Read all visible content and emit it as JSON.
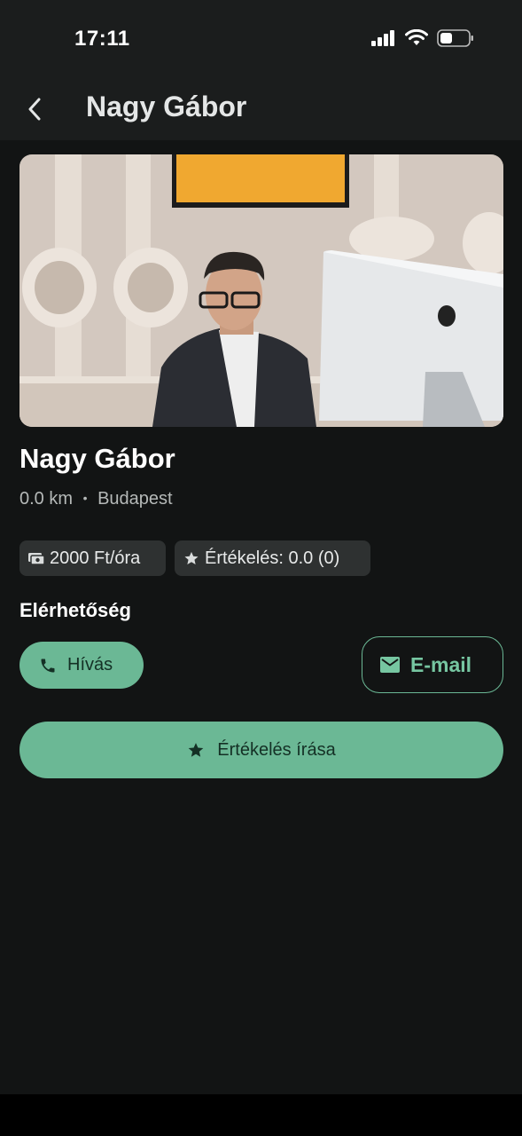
{
  "status_bar": {
    "time": "17:11"
  },
  "app_bar": {
    "title": "Nagy Gábor",
    "back_icon": "chevron-left-icon"
  },
  "profile": {
    "name": "Nagy Gábor",
    "distance": "0.0 km",
    "separator": "•",
    "city": "Budapest"
  },
  "chips": {
    "price": {
      "icon": "cash-icon",
      "label": "2000 Ft/óra"
    },
    "rating": {
      "icon": "star-icon",
      "label": "Értékelés: 0.0 (0)"
    }
  },
  "contact": {
    "title": "Elérhetőség",
    "call_label": "Hívás",
    "email_label": "E-mail"
  },
  "actions": {
    "review_label": "Értékelés írása"
  },
  "colors": {
    "background": "#121414",
    "app_bar": "#1b1d1d",
    "accent": "#6bb895",
    "chip": "#2e3131"
  }
}
